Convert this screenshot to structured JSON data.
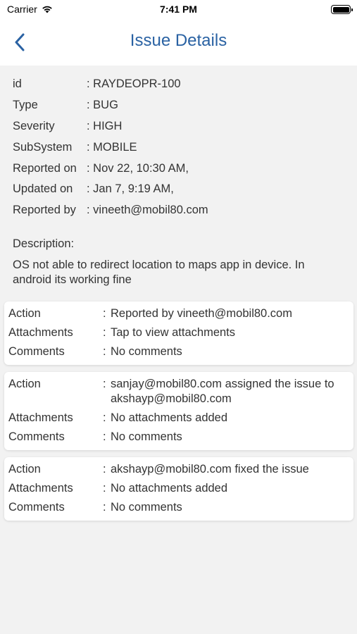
{
  "status_bar": {
    "carrier": "Carrier",
    "time": "7:41 PM"
  },
  "nav": {
    "title": "Issue Details",
    "back_icon": "chevron-left-icon"
  },
  "colors": {
    "accent": "#2a62a3",
    "background": "#f2f2f2",
    "card": "#ffffff"
  },
  "details": {
    "fields": [
      {
        "label": "id",
        "value": ": RAYDEOPR-100"
      },
      {
        "label": "Type",
        "value": ": BUG"
      },
      {
        "label": "Severity",
        "value": ": HIGH"
      },
      {
        "label": "SubSystem",
        "value": ": MOBILE"
      },
      {
        "label": "Reported on",
        "value": ": Nov 22, 10:30 AM,"
      },
      {
        "label": "Updated on",
        "value": ": Jan 7, 9:19 AM,"
      },
      {
        "label": "Reported by",
        "value": ": vineeth@mobil80.com"
      }
    ],
    "description_label": "Description:",
    "description": "OS not able to redirect location to maps app in device. In android its working fine"
  },
  "history": [
    {
      "action_label": "Action",
      "action": " Reported by vineeth@mobil80.com",
      "attachments_label": "Attachments",
      "attachments": "Tap to view attachments",
      "comments_label": "Comments",
      "comments": "No comments"
    },
    {
      "action_label": "Action",
      "action": "sanjay@mobil80.com assigned the issue to akshayp@mobil80.com",
      "attachments_label": "Attachments",
      "attachments": "No attachments added",
      "comments_label": "Comments",
      "comments": "No comments"
    },
    {
      "action_label": "Action",
      "action": "akshayp@mobil80.com fixed the issue",
      "attachments_label": "Attachments",
      "attachments": "No attachments added",
      "comments_label": "Comments",
      "comments": "No comments"
    }
  ],
  "separator": ":"
}
